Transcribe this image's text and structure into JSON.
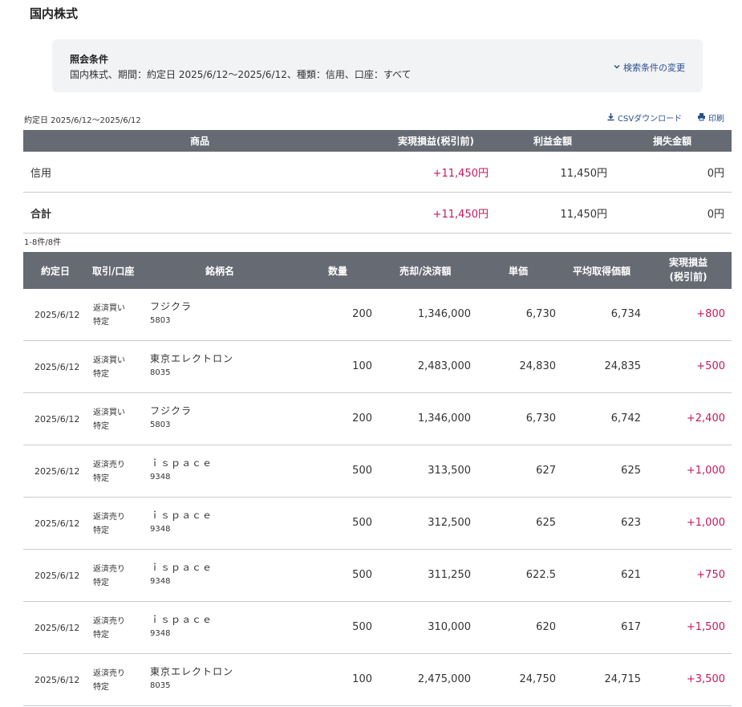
{
  "page_title": "国内株式",
  "condition": {
    "title": "照会条件",
    "text": "国内株式、期間：約定日 2025/6/12〜2025/6/12、種類：信用、口座：すべて",
    "change_label": "検索条件の変更"
  },
  "date_range": "約定日 2025/6/12〜2025/6/12",
  "csv_label": "CSVダウンロード",
  "print_label": "印刷",
  "summary": {
    "headers": {
      "product": "商品",
      "realized": "実現損益(税引前)",
      "profit": "利益金額",
      "loss": "損失金額"
    },
    "rows": [
      {
        "product": "信用",
        "realized": "+11,450円",
        "profit": "11,450円",
        "loss": "0円"
      },
      {
        "product": "合計",
        "realized": "+11,450円",
        "profit": "11,450円",
        "loss": "0円"
      }
    ]
  },
  "count_label": "1-8件/8件",
  "detail": {
    "headers": {
      "date": "約定日",
      "trade": "取引/口座",
      "name": "銘柄名",
      "qty": "数量",
      "amount": "売却/決済額",
      "price": "単価",
      "avg": "平均取得価額",
      "pl_line1": "実現損益",
      "pl_line2": "(税引前)"
    },
    "rows": [
      {
        "date": "2025/6/12",
        "trade": "返済買い",
        "account": "特定",
        "name": "フジクラ",
        "code": "5803",
        "qty": "200",
        "amount": "1,346,000",
        "price": "6,730",
        "avg": "6,734",
        "pl": "+800"
      },
      {
        "date": "2025/6/12",
        "trade": "返済買い",
        "account": "特定",
        "name": "東京エレクトロン",
        "code": "8035",
        "qty": "100",
        "amount": "2,483,000",
        "price": "24,830",
        "avg": "24,835",
        "pl": "+500"
      },
      {
        "date": "2025/6/12",
        "trade": "返済買い",
        "account": "特定",
        "name": "フジクラ",
        "code": "5803",
        "qty": "200",
        "amount": "1,346,000",
        "price": "6,730",
        "avg": "6,742",
        "pl": "+2,400"
      },
      {
        "date": "2025/6/12",
        "trade": "返済売り",
        "account": "特定",
        "name": "ｉｓｐａｃｅ",
        "code": "9348",
        "qty": "500",
        "amount": "313,500",
        "price": "627",
        "avg": "625",
        "pl": "+1,000"
      },
      {
        "date": "2025/6/12",
        "trade": "返済売り",
        "account": "特定",
        "name": "ｉｓｐａｃｅ",
        "code": "9348",
        "qty": "500",
        "amount": "312,500",
        "price": "625",
        "avg": "623",
        "pl": "+1,000"
      },
      {
        "date": "2025/6/12",
        "trade": "返済売り",
        "account": "特定",
        "name": "ｉｓｐａｃｅ",
        "code": "9348",
        "qty": "500",
        "amount": "311,250",
        "price": "622.5",
        "avg": "621",
        "pl": "+750"
      },
      {
        "date": "2025/6/12",
        "trade": "返済売り",
        "account": "特定",
        "name": "ｉｓｐａｃｅ",
        "code": "9348",
        "qty": "500",
        "amount": "310,000",
        "price": "620",
        "avg": "617",
        "pl": "+1,500"
      },
      {
        "date": "2025/6/12",
        "trade": "返済売り",
        "account": "特定",
        "name": "東京エレクトロン",
        "code": "8035",
        "qty": "100",
        "amount": "2,475,000",
        "price": "24,750",
        "avg": "24,715",
        "pl": "+3,500"
      }
    ]
  },
  "colors": {
    "header_bg": "#666a73",
    "profit": "#c7175f",
    "link": "#2a4f8f",
    "panel_bg": "#f2f3f5"
  }
}
